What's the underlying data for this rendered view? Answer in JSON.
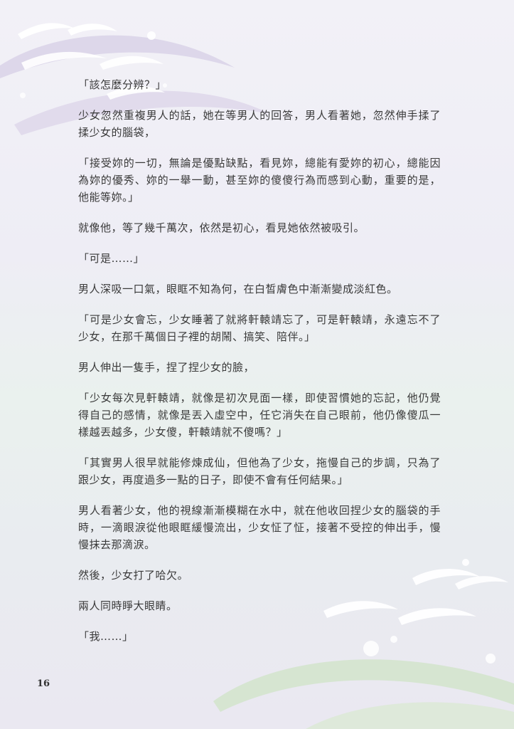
{
  "page": {
    "paragraphs": [
      "「該怎麼分辨？」",
      "少女忽然重複男人的話，她在等男人的回答，男人看著她，忽然伸手揉了揉少女的腦袋，",
      "「接受妳的一切，無論是優點缺點，看見妳，總能有愛妳的初心，總能因為妳的優秀、妳的一舉一動，甚至妳的傻傻行為而感到心動，重要的是，他能等妳。」",
      "就像他，等了幾千萬次，依然是初心，看見她依然被吸引。",
      "「可是……」",
      "男人深吸一口氣，眼眶不知為何，在白皙膚色中漸漸變成淡紅色。",
      "「可是少女會忘，少女睡著了就將軒轅靖忘了，可是軒轅靖，永遠忘不了少女，在那千萬個日子裡的胡鬧、搞笑、陪伴。」",
      "男人伸出一隻手，捏了捏少女的臉，",
      "「少女每次見軒轅靖，就像是初次見面一樣，即使習慣她的忘記，他仍覺得自己的感情，就像是丟入虛空中，任它消失在自己眼前，他仍像傻瓜一樣越丟越多，少女傻，軒轅靖就不傻嗎？」",
      "「其實男人很早就能修煉成仙，但他為了少女，拖慢自己的步調，只為了跟少女，再度過多一點的日子，即使不會有任何結果。」",
      "男人看著少女，他的視線漸漸模糊在水中，就在他收回捏少女的腦袋的手時，一滴眼淚從他眼眶緩慢流出，少女怔了怔，接著不受控的伸出手，慢慢抹去那滴淚。",
      "然後，少女打了哈欠。",
      "兩人同時睜大眼睛。",
      "「我……」"
    ],
    "page_number": "16"
  },
  "colors": {
    "text": "#3a3a3a",
    "swoosh_purple": "#d6cfe6",
    "swoosh_green": "#d7e6cf",
    "bird_white": "#ffffff"
  }
}
